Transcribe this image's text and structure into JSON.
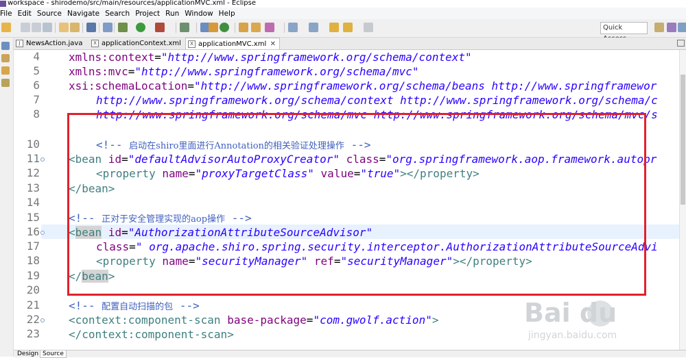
{
  "window": {
    "title": "workspace - shirodemo/src/main/resources/applicationMVC.xml - Eclipse"
  },
  "menu": [
    "File",
    "Edit",
    "Source",
    "Navigate",
    "Search",
    "Project",
    "Run",
    "Window",
    "Help"
  ],
  "toolbar": {
    "quick_access": "Quick Access"
  },
  "tabs": [
    {
      "label": "NewsAction.java",
      "icon": "java-file-icon"
    },
    {
      "label": "applicationContext.xml",
      "icon": "xml-file-icon"
    },
    {
      "label": "applicationMVC.xml",
      "icon": "xml-file-icon",
      "active": true,
      "close": "✕"
    }
  ],
  "line_numbers": [
    "4",
    "5",
    "6",
    "7",
    "8",
    "10",
    "11",
    "12",
    "13",
    "14",
    "15",
    "16",
    "17",
    "18",
    "19",
    "20",
    "21",
    "22",
    "23"
  ],
  "code": {
    "l4": {
      "attr": "xmlns:context",
      "eq": "=",
      "val": "\"http://www.springframework.org/schema/context\""
    },
    "l5": {
      "attr": "xmlns:mvc",
      "eq": "=",
      "val": "\"http://www.springframework.org/schema/mvc\""
    },
    "l6": {
      "attr": "xsi:schemaLocation",
      "eq": "=",
      "val": "\"http://www.springframework.org/schema/beans http://www.springframewor"
    },
    "l7": {
      "val": "http://www.springframework.org/schema/context http://www.springframework.org/schema/c"
    },
    "l8": {
      "val": "http://www.springframework.org/schema/mvc http://www.springframework.org/schema/mvc/s"
    },
    "l10": {
      "open": "<!-- ",
      "text": "启动在shiro里面进行Annotation的相关验证处理操作",
      "close": " -->"
    },
    "l11": {
      "tag_open": "<bean",
      "attr1": " id",
      "val1": "\"defaultAdvisorAutoProxyCreator\"",
      "attr2": " class",
      "val2": "\"org.springframework.aop.framework.autopr"
    },
    "l12": {
      "tag_open": "<property",
      "attr1": " name",
      "val1": "\"proxyTargetClass\"",
      "attr2": " value",
      "val2": "\"true\"",
      "tag_close": "></property>"
    },
    "l13": {
      "tag": "</bean>"
    },
    "l15": {
      "open": "<!-- ",
      "text": "正对于安全管理实现的aop操作",
      "close": " -->"
    },
    "l16": {
      "lt": "<",
      "tag": "bean",
      "attr1": " id",
      "val1": "\"AuthorizationAttributeSourceAdvisor\""
    },
    "l17": {
      "attr1": "class",
      "val1": "\" org.apache.shiro.spring.security.interceptor.AuthorizationAttributeSourceAdvi"
    },
    "l18": {
      "tag_open": "<property",
      "attr1": " name",
      "val1": "\"securityManager\"",
      "attr2": " ref",
      "val2": "\"securityManager\"",
      "tag_close": "></property>"
    },
    "l19": {
      "lt": "</",
      "tag": "bean",
      "gt": ">"
    },
    "l21": {
      "open": "<!-- ",
      "text": "配置自动扫描的包",
      "close": " -->"
    },
    "l22": {
      "tag_open": "<context:component-scan",
      "attr1": " base-package",
      "val1": "\"com.gwolf.action\"",
      "tag_close": ">"
    },
    "l23": {
      "tag": "</context:component-scan>"
    }
  },
  "bottom_tabs": [
    "Design",
    "Source"
  ],
  "watermark": {
    "main": "Bai du",
    "sub": "jingyan.baidu.com"
  },
  "colors": {
    "highlight_box": "#e0212b",
    "xml_tag": "#3f7f7f",
    "xml_attr": "#7f007f",
    "xml_value": "#2a00ff",
    "comment": "#3f5fbf"
  }
}
